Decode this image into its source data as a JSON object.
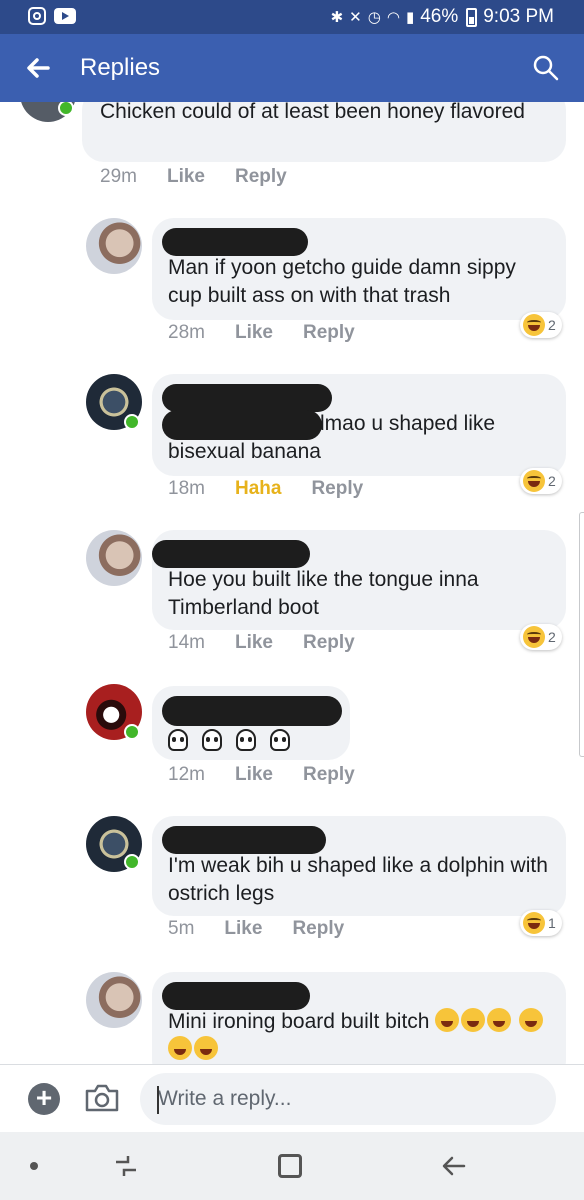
{
  "status_bar": {
    "battery": "46%",
    "time": "9:03 PM",
    "icons": [
      "instagram-icon",
      "youtube-icon",
      "bluetooth-icon",
      "mute-icon",
      "alarm-icon",
      "wifi-icon",
      "signal-icon",
      "battery-icon"
    ]
  },
  "app_bar": {
    "title": "Replies",
    "icons": [
      "back-arrow-icon",
      "search-icon"
    ]
  },
  "comments": [
    {
      "text": "Chicken could of at least been honey flavored",
      "time": "29m",
      "like": "Like",
      "reply": "Reply",
      "online": true
    },
    {
      "text": "Man if yoon getcho guide damn sippy cup built ass on with that trash",
      "time": "28m",
      "like": "Like",
      "reply": "Reply",
      "reaction_count": "2",
      "online": false
    },
    {
      "text_line1": "lmao u shaped like",
      "text_line2": "bisexual  banana",
      "time": "18m",
      "like": "Haha",
      "reply": "Reply",
      "reaction_count": "2",
      "online": true
    },
    {
      "text": "Hoe you built like the tongue inna Timberland boot",
      "time": "14m",
      "like": "Like",
      "reply": "Reply",
      "reaction_count": "2",
      "online": false
    },
    {
      "emoji": "skull x4",
      "time": "12m",
      "like": "Like",
      "reply": "Reply",
      "online": true
    },
    {
      "text": "I'm weak bih  u shaped  like a   dolphin with  ostrich legs",
      "time": "5m",
      "like": "Like",
      "reply": "Reply",
      "reaction_count": "1",
      "online": true
    },
    {
      "text": "Mini ironing board built bitch",
      "online": false
    }
  ],
  "composer": {
    "placeholder": "Write a reply..."
  },
  "colors": {
    "status_bar": "#2d4a8a",
    "app_bar": "#3b5fb0",
    "bubble": "#f0f2f5",
    "online": "#42b72a",
    "haha": "#e7b21b"
  }
}
